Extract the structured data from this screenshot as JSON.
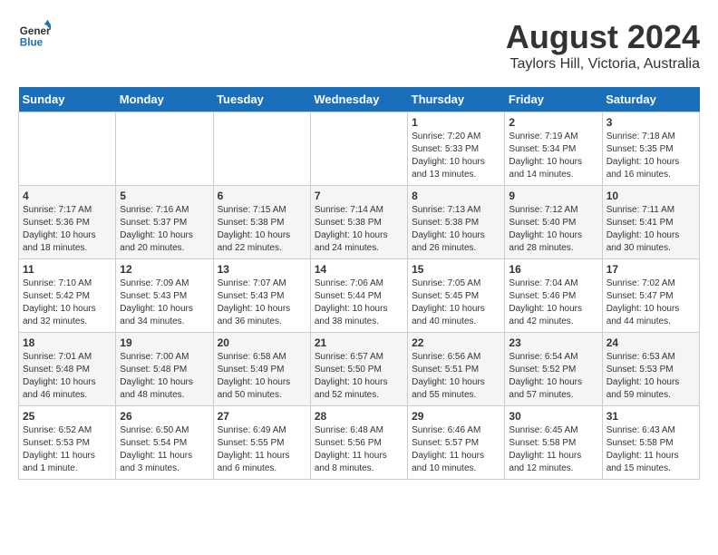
{
  "logo": {
    "line1": "General",
    "line2": "Blue"
  },
  "title": "August 2024",
  "subtitle": "Taylors Hill, Victoria, Australia",
  "days_of_week": [
    "Sunday",
    "Monday",
    "Tuesday",
    "Wednesday",
    "Thursday",
    "Friday",
    "Saturday"
  ],
  "weeks": [
    [
      {
        "day": "",
        "info": ""
      },
      {
        "day": "",
        "info": ""
      },
      {
        "day": "",
        "info": ""
      },
      {
        "day": "",
        "info": ""
      },
      {
        "day": "1",
        "info": "Sunrise: 7:20 AM\nSunset: 5:33 PM\nDaylight: 10 hours\nand 13 minutes."
      },
      {
        "day": "2",
        "info": "Sunrise: 7:19 AM\nSunset: 5:34 PM\nDaylight: 10 hours\nand 14 minutes."
      },
      {
        "day": "3",
        "info": "Sunrise: 7:18 AM\nSunset: 5:35 PM\nDaylight: 10 hours\nand 16 minutes."
      }
    ],
    [
      {
        "day": "4",
        "info": "Sunrise: 7:17 AM\nSunset: 5:36 PM\nDaylight: 10 hours\nand 18 minutes."
      },
      {
        "day": "5",
        "info": "Sunrise: 7:16 AM\nSunset: 5:37 PM\nDaylight: 10 hours\nand 20 minutes."
      },
      {
        "day": "6",
        "info": "Sunrise: 7:15 AM\nSunset: 5:38 PM\nDaylight: 10 hours\nand 22 minutes."
      },
      {
        "day": "7",
        "info": "Sunrise: 7:14 AM\nSunset: 5:38 PM\nDaylight: 10 hours\nand 24 minutes."
      },
      {
        "day": "8",
        "info": "Sunrise: 7:13 AM\nSunset: 5:38 PM\nDaylight: 10 hours\nand 26 minutes."
      },
      {
        "day": "9",
        "info": "Sunrise: 7:12 AM\nSunset: 5:40 PM\nDaylight: 10 hours\nand 28 minutes."
      },
      {
        "day": "10",
        "info": "Sunrise: 7:11 AM\nSunset: 5:41 PM\nDaylight: 10 hours\nand 30 minutes."
      }
    ],
    [
      {
        "day": "11",
        "info": "Sunrise: 7:10 AM\nSunset: 5:42 PM\nDaylight: 10 hours\nand 32 minutes."
      },
      {
        "day": "12",
        "info": "Sunrise: 7:09 AM\nSunset: 5:43 PM\nDaylight: 10 hours\nand 34 minutes."
      },
      {
        "day": "13",
        "info": "Sunrise: 7:07 AM\nSunset: 5:43 PM\nDaylight: 10 hours\nand 36 minutes."
      },
      {
        "day": "14",
        "info": "Sunrise: 7:06 AM\nSunset: 5:44 PM\nDaylight: 10 hours\nand 38 minutes."
      },
      {
        "day": "15",
        "info": "Sunrise: 7:05 AM\nSunset: 5:45 PM\nDaylight: 10 hours\nand 40 minutes."
      },
      {
        "day": "16",
        "info": "Sunrise: 7:04 AM\nSunset: 5:46 PM\nDaylight: 10 hours\nand 42 minutes."
      },
      {
        "day": "17",
        "info": "Sunrise: 7:02 AM\nSunset: 5:47 PM\nDaylight: 10 hours\nand 44 minutes."
      }
    ],
    [
      {
        "day": "18",
        "info": "Sunrise: 7:01 AM\nSunset: 5:48 PM\nDaylight: 10 hours\nand 46 minutes."
      },
      {
        "day": "19",
        "info": "Sunrise: 7:00 AM\nSunset: 5:48 PM\nDaylight: 10 hours\nand 48 minutes."
      },
      {
        "day": "20",
        "info": "Sunrise: 6:58 AM\nSunset: 5:49 PM\nDaylight: 10 hours\nand 50 minutes."
      },
      {
        "day": "21",
        "info": "Sunrise: 6:57 AM\nSunset: 5:50 PM\nDaylight: 10 hours\nand 52 minutes."
      },
      {
        "day": "22",
        "info": "Sunrise: 6:56 AM\nSunset: 5:51 PM\nDaylight: 10 hours\nand 55 minutes."
      },
      {
        "day": "23",
        "info": "Sunrise: 6:54 AM\nSunset: 5:52 PM\nDaylight: 10 hours\nand 57 minutes."
      },
      {
        "day": "24",
        "info": "Sunrise: 6:53 AM\nSunset: 5:53 PM\nDaylight: 10 hours\nand 59 minutes."
      }
    ],
    [
      {
        "day": "25",
        "info": "Sunrise: 6:52 AM\nSunset: 5:53 PM\nDaylight: 11 hours\nand 1 minute."
      },
      {
        "day": "26",
        "info": "Sunrise: 6:50 AM\nSunset: 5:54 PM\nDaylight: 11 hours\nand 3 minutes."
      },
      {
        "day": "27",
        "info": "Sunrise: 6:49 AM\nSunset: 5:55 PM\nDaylight: 11 hours\nand 6 minutes."
      },
      {
        "day": "28",
        "info": "Sunrise: 6:48 AM\nSunset: 5:56 PM\nDaylight: 11 hours\nand 8 minutes."
      },
      {
        "day": "29",
        "info": "Sunrise: 6:46 AM\nSunset: 5:57 PM\nDaylight: 11 hours\nand 10 minutes."
      },
      {
        "day": "30",
        "info": "Sunrise: 6:45 AM\nSunset: 5:58 PM\nDaylight: 11 hours\nand 12 minutes."
      },
      {
        "day": "31",
        "info": "Sunrise: 6:43 AM\nSunset: 5:58 PM\nDaylight: 11 hours\nand 15 minutes."
      }
    ]
  ]
}
